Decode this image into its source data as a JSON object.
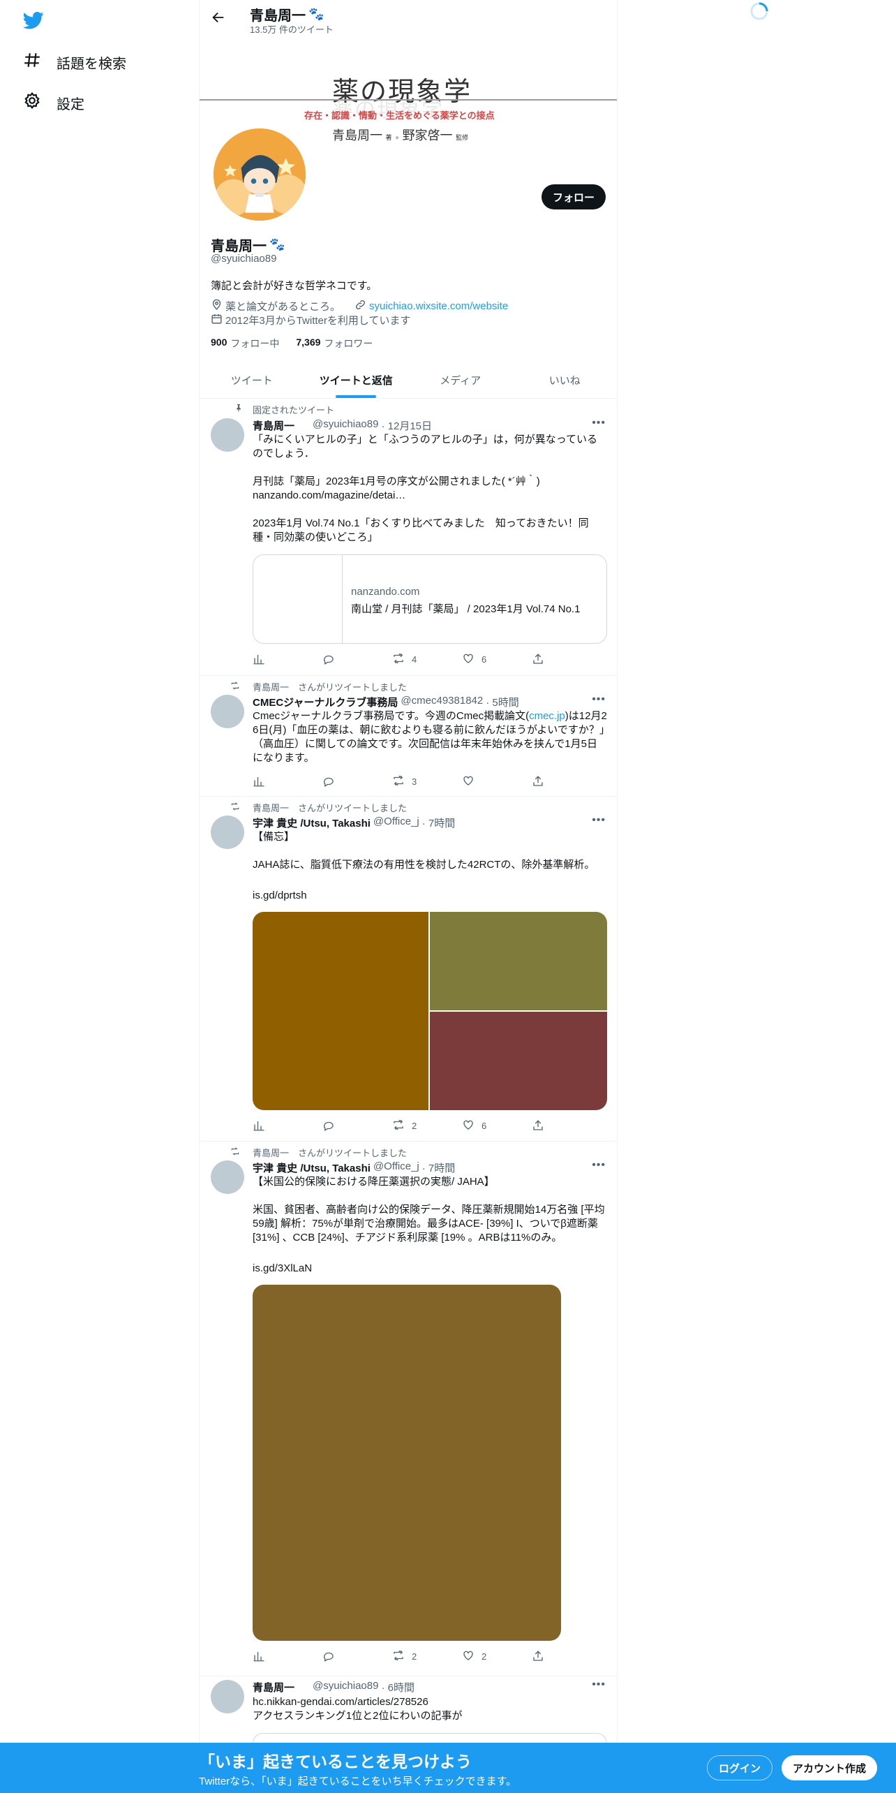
{
  "nav": {
    "explore_label": "話題を検索",
    "settings_label": "設定"
  },
  "header": {
    "name": "青島周一",
    "tweet_count": "13.5万 件のツイート"
  },
  "banner": {
    "title": "薬の現象学",
    "subtitle": "存在・認識・情動・生活をめぐる薬学との接点",
    "author1": "青島周一",
    "author1_role": "著",
    "author2": "野家啓一",
    "author2_role": "監修"
  },
  "profile": {
    "name": "青島周一",
    "handle": "@syuichiao89",
    "bio": "簿記と会計が好きな哲学ネコです。",
    "location": "薬と論文があるところ。",
    "website": "syuichiao.wixsite.com/website",
    "joined": "2012年3月からTwitterを利用しています",
    "following_count": "900",
    "following_label": "フォロー中",
    "followers_count": "7,369",
    "followers_label": "フォロワー",
    "follow_button": "フォロー"
  },
  "tabs": [
    "ツイート",
    "ツイートと返信",
    "メディア",
    "いいね"
  ],
  "tweets": [
    {
      "social": "固定されたツイート",
      "name": "青島周一",
      "handle": "@syuichiao89",
      "time": "· 12月15日",
      "text": "「みにくいアヒルの子」と「ふつうのアヒルの子」は，何が異なっているのでしょう．\n\n月刊誌「薬局」2023年1月号の序文が公開されました( *´艸｀)",
      "link": "nanzando.com/magazine/detai…",
      "text2": "2023年1月 Vol.74 No.1「おくすり比べてみました　知っておきたい！同種・同効薬の使いどころ」",
      "card_domain": "nanzando.com",
      "card_title": "南山堂 / 月刊誌「薬局」 / 2023年1月 Vol.74 No.1",
      "retweets": "4",
      "likes": "6"
    },
    {
      "social": "青島周一　さんがリツイートしました",
      "name": "CMECジャーナルクラブ事務局",
      "handle": "@cmec49381842",
      "time": "· 5時間",
      "text_a": "Cmecジャーナルクラブ事務局です。今週のCmec掲載論文(",
      "link": "cmec.jp",
      "text_b": ")は12月26日(月)「血圧の薬は、朝に飲むよりも寝る前に飲んだほうがよいですか？」（高血圧）に関しての論文です。次回配信は年末年始休みを挟んで1月5日になります。",
      "retweets": "3",
      "likes": ""
    },
    {
      "social": "青島周一　さんがリツイートしました",
      "name": "宇津 貴史 /Utsu, Takashi",
      "handle": "@Office_j",
      "time": "· 7時間",
      "text": "【備忘】\n\nJAHA誌に、脂質低下療法の有用性を検討した42RCTの、除外基準解析。",
      "link": "is.gd/dprtsh",
      "retweets": "2",
      "likes": "6"
    },
    {
      "social": "青島周一　さんがリツイートしました",
      "name": "宇津 貴史 /Utsu, Takashi",
      "handle": "@Office_j",
      "time": "· 7時間",
      "text": "【米国公的保険における降圧薬選択の実態/ JAHA】\n\n米国、貧困者、高齢者向け公的保険データ、降圧薬新規開始14万名強 [平均59歳] 解析：75%が単剤で治療開始。最多はACE- [39%] I、ついでβ遮断薬 [31%] 、CCB [24%]、チアジド系利尿薬 [19% 。ARBは11%のみ。",
      "link": "is.gd/3XlLaN",
      "retweets": "2",
      "likes": "2"
    },
    {
      "name": "青島周一",
      "handle": "@syuichiao89",
      "time": "· 6時間",
      "link": "hc.nikkan-gendai.com/articles/278526",
      "text": "アクセスランキング1位と2位にわいの記事が"
    }
  ],
  "bottom": {
    "title": "「いま」起きていることを見つけよう",
    "subtitle": "Twitterなら、「いま」起きていることをいち早くチェックできます。",
    "login": "ログイン",
    "signup": "アカウント作成"
  },
  "colors": {
    "accent": "#1d9bf0",
    "media1": "#8f5f00",
    "media2": "#7e7b3b",
    "media3": "#7b3b3b",
    "media4": "#826429"
  }
}
